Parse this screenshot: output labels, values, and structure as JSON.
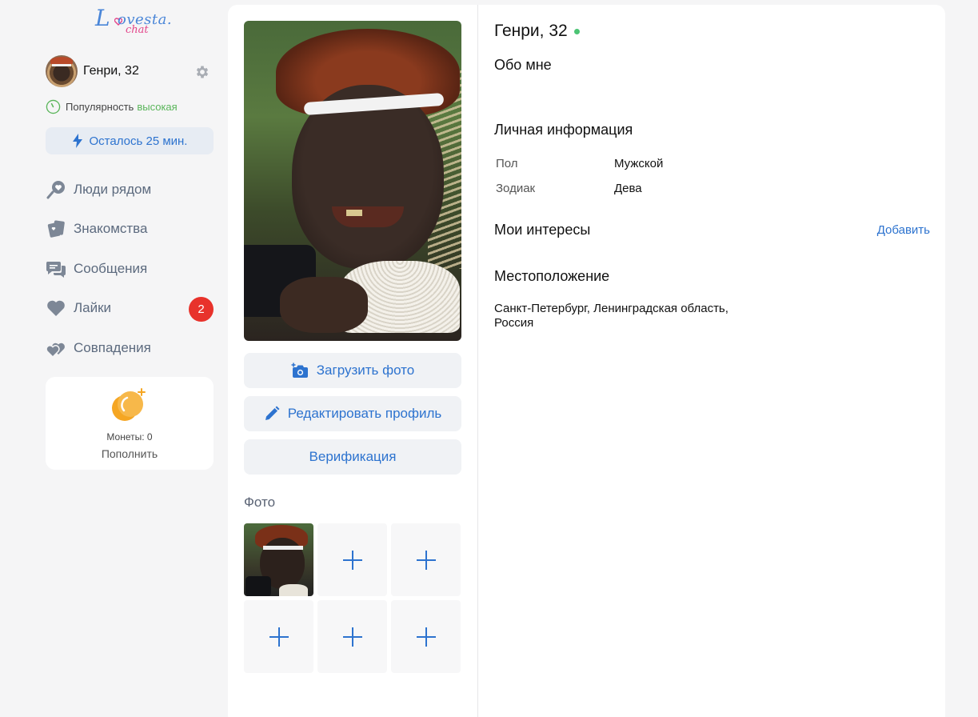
{
  "logo": {
    "text_main": "ovesta.",
    "text_sub": "chat",
    "letter": "L"
  },
  "user": {
    "name": "Генри, 32"
  },
  "popularity": {
    "label": "Популярность",
    "value": "высокая"
  },
  "timer": {
    "label": "Осталось 25 мин."
  },
  "nav": {
    "items": [
      {
        "label": "Люди рядом",
        "icon": "location-heart-icon"
      },
      {
        "label": "Знакомства",
        "icon": "cards-icon"
      },
      {
        "label": "Сообщения",
        "icon": "chat-bubbles-icon"
      },
      {
        "label": "Лайки",
        "icon": "heart-icon",
        "badge": "2"
      },
      {
        "label": "Совпадения",
        "icon": "double-heart-icon"
      }
    ]
  },
  "coins": {
    "label": "Монеты: 0",
    "refill": "Пополнить"
  },
  "actions": {
    "upload": "Загрузить фото",
    "edit": "Редактировать профиль",
    "verify": "Верификация"
  },
  "photos": {
    "title": "Фото"
  },
  "profile": {
    "name": "Генри, 32",
    "about_title": "Обо мне",
    "personal_title": "Личная информация",
    "gender_key": "Пол",
    "gender_val": "Мужской",
    "zodiac_key": "Зодиак",
    "zodiac_val": "Дева",
    "interests_title": "Мои интересы",
    "interests_add": "Добавить",
    "location_title": "Местоположение",
    "location_line1": "Санкт-Петербург, Ленинградская область,",
    "location_line2": "Россия"
  },
  "colors": {
    "accent": "#2d73cf",
    "badge": "#e8322b",
    "online": "#4bc474",
    "popularity_high": "#5ab55a"
  }
}
